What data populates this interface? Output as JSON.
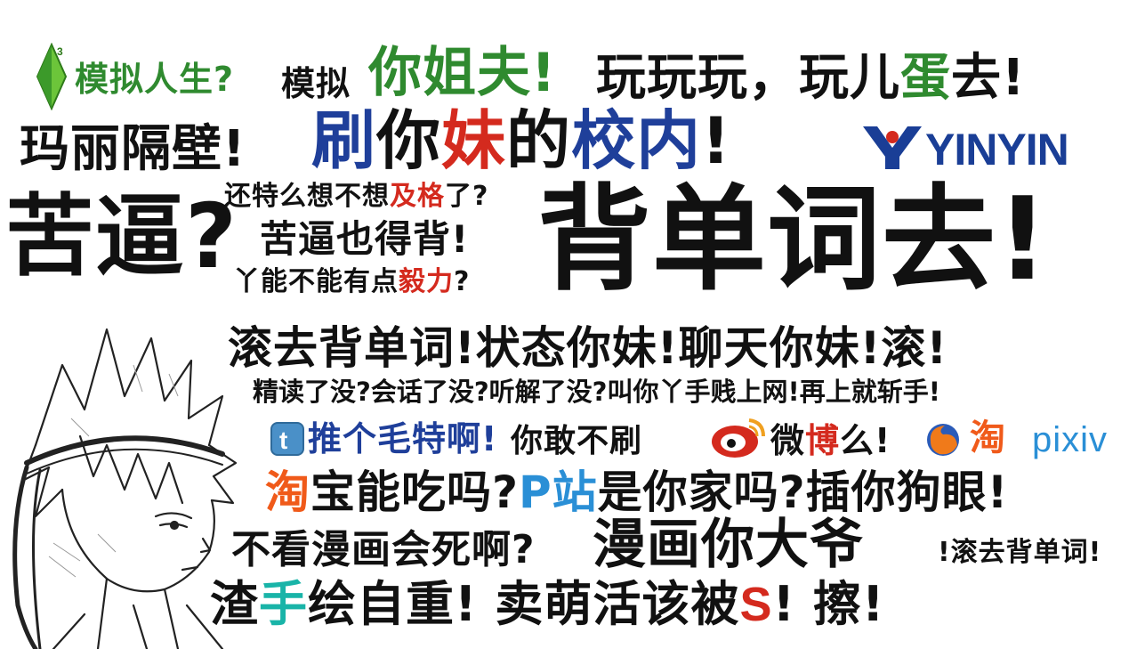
{
  "poster": {
    "line1": {
      "sims_text": "模拟人生?",
      "fake_text": "模拟",
      "jiefu": "你姐夫!",
      "wan": "玩玩玩，玩儿",
      "dan": "蛋",
      "qu": "去!"
    },
    "line2": {
      "mali": "玛丽隔壁!",
      "shua": "刷",
      "ni": "你",
      "mei": "妹",
      "de": "的",
      "xiaonei": "校内",
      "bang": "!",
      "yinyin": "YINYIN"
    },
    "block3": {
      "kubi": "苦逼?",
      "q1a": "还特么想不想",
      "q1b": "及格",
      "q1c": "了?",
      "q2": "苦逼也得背!",
      "q3a": "丫能不能有点",
      "q3b": "毅力",
      "q3c": "?",
      "big": "背单词去!"
    },
    "line4": "滚去背单词!状态你妹!聊天你妹!滚!",
    "line5": "精读了没?会话了没?听解了没?叫你丫手贱上网!再上就斩手!",
    "line6": {
      "twitter_text": "推个毛特啊!",
      "dare": "你敢不刷",
      "wei": "微",
      "bo": "博",
      "me": "么!",
      "taobao_logo": "淘",
      "pixiv": "pixiv"
    },
    "line7": {
      "tao": "淘",
      "rest1": "宝能吃吗?",
      "pzhan": "P站",
      "rest2": "是你家吗?插你狗眼!"
    },
    "line8": {
      "a": "不看漫画会死啊?",
      "b": "漫画你大爷",
      "c": "!滚去背单词!"
    },
    "line9": {
      "zha": "渣",
      "shou": "手",
      "rest1": "绘自重! 卖萌活该被",
      "s": "S",
      "rest2": "! 擦!"
    },
    "colors": {
      "black": "#111111",
      "blue": "#1f3f9a",
      "red": "#d42a1e",
      "green": "#2f8a2f",
      "yinyin_blue": "#1a3e96",
      "twitter": "#4a90c8",
      "pixiv": "#2a8fd6",
      "taobao": "#f05a1a",
      "teal": "#19b4a8"
    },
    "icons": [
      "sims-plumbob-icon",
      "twitter-icon",
      "weibo-icon",
      "firefox-icon",
      "taobao-icon",
      "anime-character-illustration"
    ]
  }
}
